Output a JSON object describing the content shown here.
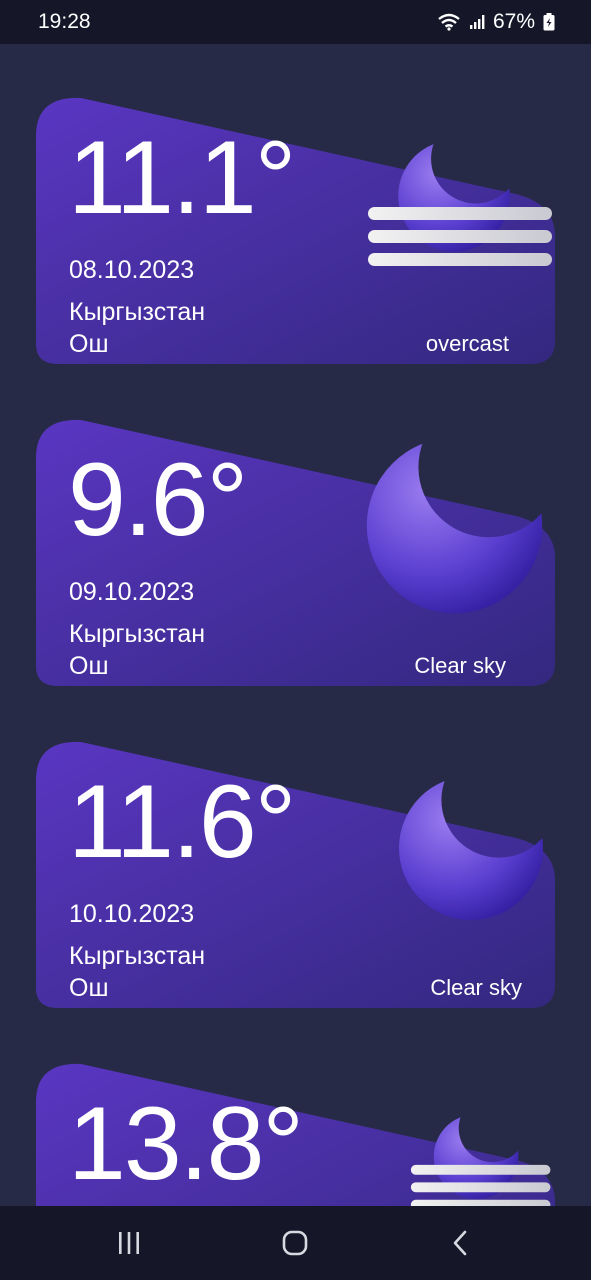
{
  "status": {
    "time": "19:28",
    "battery": "67%"
  },
  "forecasts": [
    {
      "temp": "11.1°",
      "date": "08.10.2023",
      "country": "Кыргызстан",
      "city": "Ош",
      "condition": "overcast",
      "icon": "moon-wind-icon"
    },
    {
      "temp": "9.6°",
      "date": "09.10.2023",
      "country": "Кыргызстан",
      "city": "Ош",
      "condition": "Clear sky",
      "icon": "moon-icon"
    },
    {
      "temp": "11.6°",
      "date": "10.10.2023",
      "country": "Кыргызстан",
      "city": "Ош",
      "condition": "Clear sky",
      "icon": "moon-icon"
    },
    {
      "temp": "13.8°",
      "icon": "moon-wind-icon"
    }
  ],
  "colors": {
    "background": "#262a46",
    "card_start": "#5b37c0",
    "card_end": "#362a86",
    "bars": "#151728"
  }
}
